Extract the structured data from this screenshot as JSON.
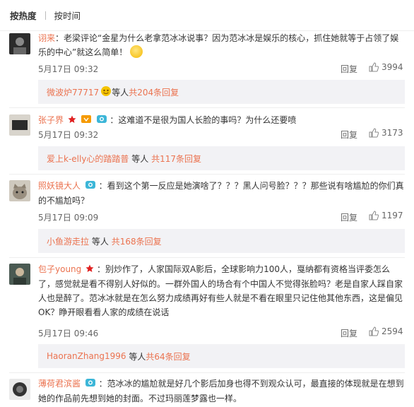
{
  "sort": {
    "hot": "按热度",
    "time": "按时间"
  },
  "comments": [
    {
      "user": "诩来",
      "text": "：老梁评论“金星为什么老拿范冰冰说事？因为范冰冰是娱乐的核心，抓住她就等于占领了娱乐的中心”就这么简单！",
      "date": "5月17日 09:32",
      "reply": "回复",
      "likes": "3994",
      "replies": {
        "user": "微波炉77717",
        "mid": "等人",
        "more": "共204条回复"
      }
    },
    {
      "user": "张子界",
      "text": "：这难道不是很为国人长脸的事吗？为什么还要喷",
      "date": "5月17日 09:32",
      "reply": "回复",
      "likes": "3173",
      "replies": {
        "user": "爱上k-elly心的踏踏普",
        "mid": "等人",
        "more": "共117条回复"
      }
    },
    {
      "user": "照妖镜大人",
      "text": "：看到这个第一反应是她演啥了？？？黑人问号脸？？？那些说有啥尴尬的你们真的不尴尬吗？",
      "date": "5月17日 09:09",
      "reply": "回复",
      "likes": "1197",
      "replies": {
        "user": "小鱼游走拉",
        "mid": "等人",
        "more": "共168条回复"
      }
    },
    {
      "user": "包子young",
      "text": "：别炒作了，人家国际双A影后，全球影响力100人，戛纳都有资格当评委怎么了，感觉就是看不得别人好似的。一群外国人的场合有个中国人不觉得张脸吗？老是自家人踩自家人也是醉了。范冰冰就是在怎么努力成绩再好有些人就是不看在眼里只记住他其他东西，这是偏见OK？睁开眼看看人家的成绩在说话",
      "date": "5月17日 09:46",
      "reply": "回复",
      "likes": "2594",
      "replies": {
        "user": "HaoranZhang1996",
        "mid": "等人",
        "more": "共64条回复"
      }
    },
    {
      "user": "薄荷君滨酱",
      "text": "：范冰冰的尴尬就是好几个影后加身也得不到观众认可，最直接的体现就是在想到她的作品前先想到她的封面。不过玛丽莲梦露也一样。"
    }
  ],
  "colors": {
    "accent": "#eb7350",
    "reply_bg": "#f2f2f5"
  }
}
